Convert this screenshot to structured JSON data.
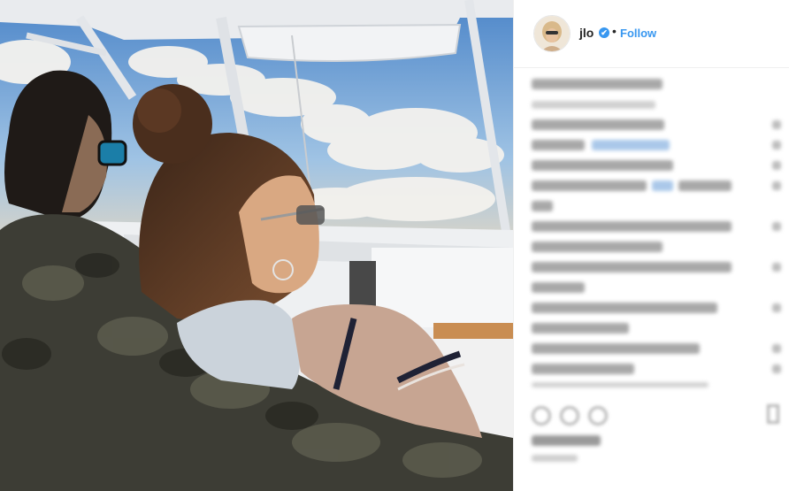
{
  "post": {
    "username": "jlo",
    "verified_mark": "✔",
    "separator": "•",
    "follow_label": "Follow"
  },
  "icons": {
    "verified": "verified-badge-icon",
    "like": "heart-icon",
    "comment": "comment-icon",
    "share": "share-icon",
    "save": "bookmark-icon"
  },
  "colors": {
    "accent": "#3897f0",
    "username": "#262626",
    "divider": "#efefef"
  }
}
